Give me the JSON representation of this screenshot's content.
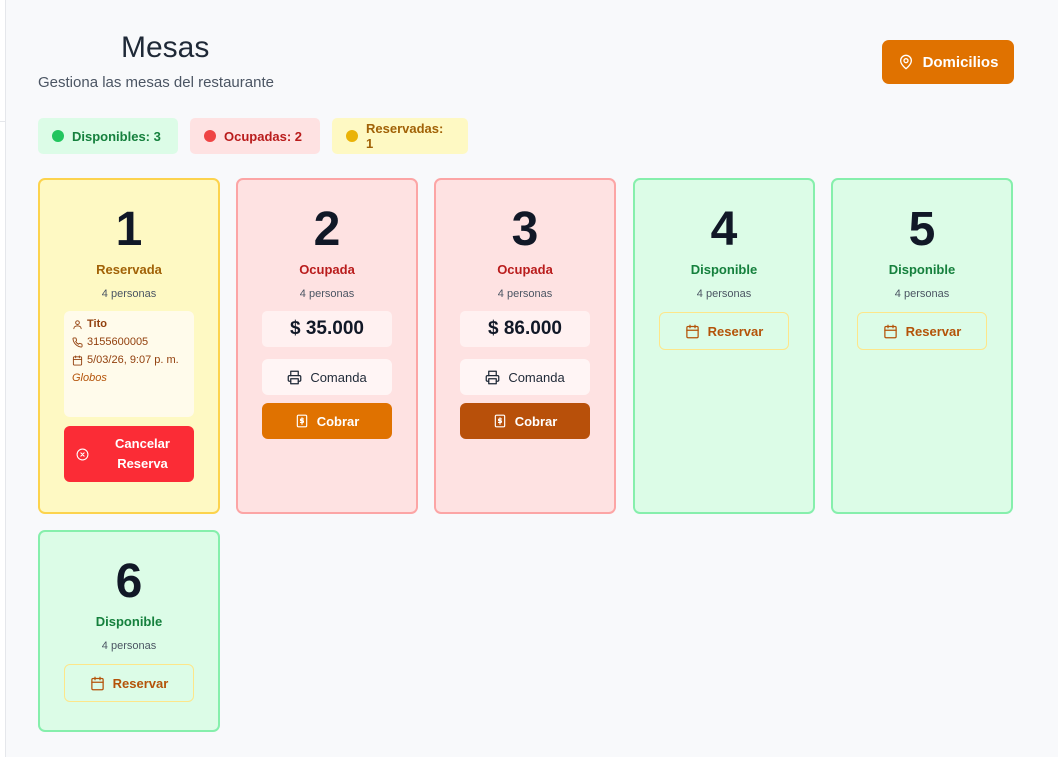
{
  "header": {
    "title": "Mesas",
    "subtitle": "Gestiona las mesas del restaurante",
    "domicilios_label": "Domicilios"
  },
  "summary": {
    "disponibles": "Disponibles: 3",
    "ocupadas": "Ocupadas: 2",
    "reservadas": "Reservadas: 1"
  },
  "tables": [
    {
      "number": "1",
      "status": "Reservada",
      "capacity": "4 personas",
      "reservation": {
        "name": "Tito",
        "phone": "3155600005",
        "datetime": "5/03/26, 9:07 p. m.",
        "note": "Globos"
      },
      "cancel_label": "Cancelar Reserva"
    },
    {
      "number": "2",
      "status": "Ocupada",
      "capacity": "4 personas",
      "amount": "$ 35.000",
      "comanda_label": "Comanda",
      "cobrar_label": "Cobrar"
    },
    {
      "number": "3",
      "status": "Ocupada",
      "capacity": "4 personas",
      "amount": "$ 86.000",
      "comanda_label": "Comanda",
      "cobrar_label": "Cobrar"
    },
    {
      "number": "4",
      "status": "Disponible",
      "capacity": "4 personas",
      "reservar_label": "Reservar"
    },
    {
      "number": "5",
      "status": "Disponible",
      "capacity": "4 personas",
      "reservar_label": "Reservar"
    },
    {
      "number": "6",
      "status": "Disponible",
      "capacity": "4 personas",
      "reservar_label": "Reservar"
    }
  ],
  "colors": {
    "accent": "#e07200",
    "available": "#dcfce7",
    "occupied": "#fee2e2",
    "reserved": "#fef9c3",
    "danger": "#fb2c36"
  }
}
